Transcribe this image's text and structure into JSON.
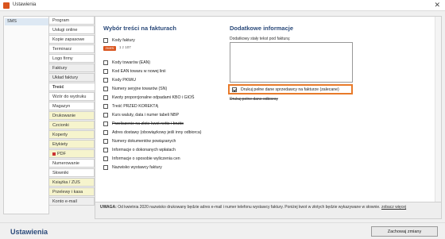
{
  "window": {
    "title": "Ustawienia",
    "close": "✕"
  },
  "left_panel": {
    "item": "SMS"
  },
  "nav": [
    {
      "label": "Program",
      "style": ""
    },
    {
      "label": "Usługi online",
      "style": ""
    },
    {
      "label": "Kopie zapasowe",
      "style": ""
    },
    {
      "label": "Terminarz",
      "style": ""
    },
    {
      "label": "Logo firmy",
      "style": ""
    },
    {
      "label": "Faktury",
      "style": "sec"
    },
    {
      "label": "Układ faktury",
      "style": "sec"
    },
    {
      "label": "Treść",
      "style": "active"
    },
    {
      "label": "Wzór do wydruku",
      "style": ""
    },
    {
      "label": "Magazyn",
      "style": ""
    },
    {
      "label": "Drukowanie",
      "style": "hl"
    },
    {
      "label": "Czcionki",
      "style": "hl"
    },
    {
      "label": "Koperty",
      "style": "hl"
    },
    {
      "label": "Etykiety",
      "style": "hl"
    },
    {
      "label": "PDF",
      "style": "hl"
    },
    {
      "label": "Numerowanie",
      "style": ""
    },
    {
      "label": "Słowniki",
      "style": ""
    },
    {
      "label": "Książka / ZUS",
      "style": "hl"
    },
    {
      "label": "Przelewy i kasa",
      "style": "hl"
    },
    {
      "label": "Konto e-mail",
      "style": "sec"
    }
  ],
  "left_section": {
    "title": "Wybór treści na fakturach",
    "options": [
      {
        "label": "Kody faktury",
        "checked": false,
        "strike": false
      },
      {
        "label": "Kody towarów (EAN)",
        "checked": false,
        "strike": false
      },
      {
        "label": "Kod EAN towaru w nowej linii",
        "checked": false,
        "strike": false
      },
      {
        "label": "Kody PKWiU",
        "checked": false,
        "strike": false
      },
      {
        "label": "Numery seryjne towarów (SN)",
        "checked": false,
        "strike": false
      },
      {
        "label": "Kwoty proporcjonalne odpadami KBO i GIOŚ",
        "checked": false,
        "strike": false
      },
      {
        "label": "Treść PRZED KOREKTĄ",
        "checked": false,
        "strike": false
      },
      {
        "label": "Kurs waluty, data i numer tabeli NBP",
        "checked": false,
        "strike": false
      },
      {
        "label": "Przeliczenie na złote kwot netto i brutto",
        "checked": false,
        "strike": true
      },
      {
        "label": "Adres dostawy (obowiązkowy jeśli inny odbiorca)",
        "checked": false,
        "strike": false
      },
      {
        "label": "Numery dokumentów powiązanych",
        "checked": false,
        "strike": false
      },
      {
        "label": "Informacje o dokonanych wpłatach",
        "checked": false,
        "strike": false
      },
      {
        "label": "Informacje o sposobie wyliczenia cen",
        "checked": false,
        "strike": false
      },
      {
        "label": "Nazwisko wystawcy faktury",
        "checked": false,
        "strike": false
      }
    ],
    "badge": "ZMIEŃ",
    "badge_value": "1 z 107"
  },
  "right_section": {
    "title": "Dodatkowe informacje",
    "field_label": "Dodatkowy stały tekst pod fakturą:",
    "field_value": "",
    "highlight_option": {
      "label": "Drukuj pełne dane sprzedawcy na fakturze (zalecane)",
      "checked": true
    },
    "extra_option": "Drukuj pełne dane odbiorcy"
  },
  "notice": {
    "bold": "UWAGA:",
    "text": "Od kwietnia 2020 nazwisko drukowany będzie adres e-mail i numer telefonu wystawcy faktury. Poniżej kwot w złotych będzie wykazywane w słownie.",
    "link": "zobacz więcej"
  },
  "footer": {
    "title": "Ustawienia",
    "save_label": "Zachowaj zmiany"
  }
}
